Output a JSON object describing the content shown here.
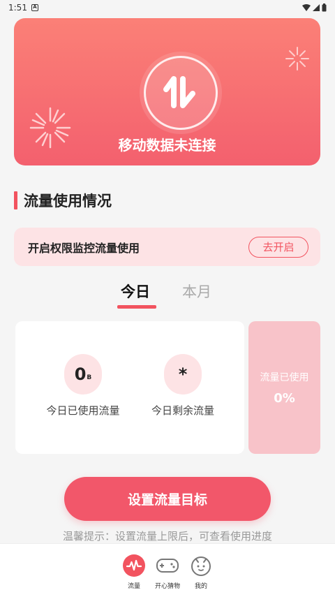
{
  "status_bar": {
    "time": "1:51",
    "notification_letter": "A"
  },
  "hero": {
    "connection_status": "移动数据未连接"
  },
  "section": {
    "title": "流量使用情况"
  },
  "permission": {
    "text": "开启权限监控流量使用",
    "button_label": "去开启"
  },
  "tabs": [
    {
      "label": "今日",
      "active": true
    },
    {
      "label": "本月",
      "active": false
    }
  ],
  "stats": {
    "used": {
      "value": "0",
      "unit": "B",
      "label": "今日已使用流量"
    },
    "remaining": {
      "value": "*",
      "label": "今日剩余流量"
    }
  },
  "usage_card": {
    "label": "流量已使用",
    "percent": "0%"
  },
  "cta": {
    "label": "设置流量目标"
  },
  "tip": {
    "text": "温馨提示：设置流量上限后，可查看使用进度"
  },
  "bottom_nav": [
    {
      "label": "流量",
      "icon": "pulse-icon",
      "active": true
    },
    {
      "label": "开心猜物",
      "icon": "gamepad-icon",
      "active": false
    },
    {
      "label": "我的",
      "icon": "face-icon",
      "active": false
    }
  ],
  "colors": {
    "accent": "#f2535f",
    "hero_top": "#fb8077",
    "hero_bottom": "#f3606e",
    "pink_light": "#fde3e5",
    "usage_card": "#f8c3c9"
  }
}
